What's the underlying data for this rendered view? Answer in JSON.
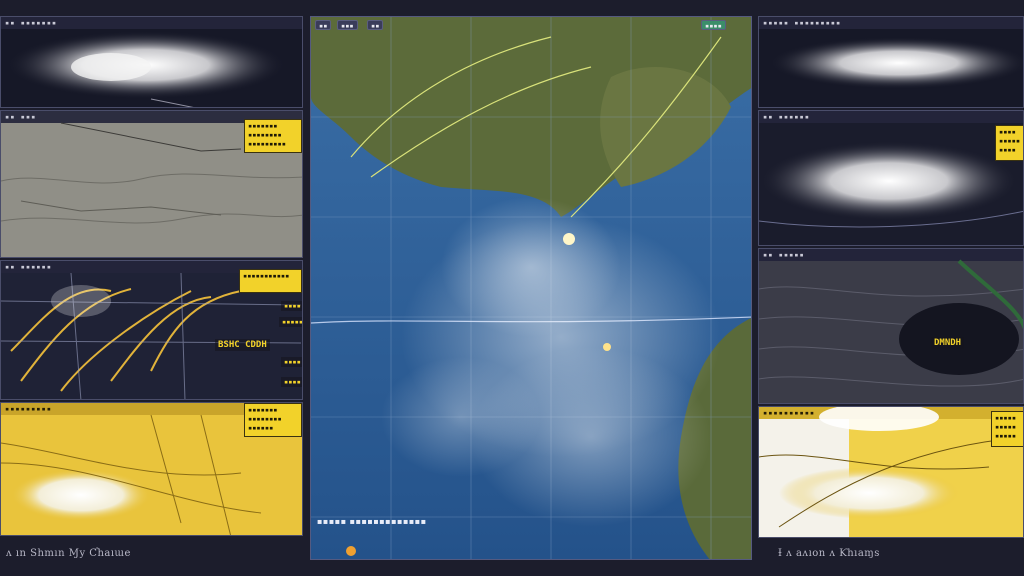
{
  "app": {
    "theme_colors": {
      "background": "#1c1d2c",
      "accent": "#f2d22a",
      "ocean": "#2e5f96"
    }
  },
  "left_column": {
    "panel1": {
      "header": "▪▪ ▪▪▪▪▪▪▪",
      "icon": "cyclone-satellite-icon"
    },
    "panel2": {
      "header": "▪▪ ▪▪▪",
      "tag": "▪▪▪▪▪▪▪\n▪▪▪▪▪▪▪▪\n▪▪▪▪▪▪▪▪▪"
    },
    "panel3": {
      "header": "▪▪ ▪▪▪▪▪▪",
      "tag": "▪▪▪▪▪▪▪▪▪▪▪",
      "label_main": "BSHC CDDH",
      "side_labels": [
        "▪▪▪▪",
        "▪▪▪▪▪",
        "▪▪▪▪",
        "▪▪▪▪"
      ]
    },
    "panel4": {
      "header": "▪▪▪▪▪▪▪▪▪",
      "tag": "▪▪▪▪▪▪▪\n▪▪▪▪▪▪▪▪\n▪▪▪▪▪▪"
    }
  },
  "center_map": {
    "chips": [
      "▪▪",
      "▪▪▪",
      "▪▪",
      "▪▪▪▪"
    ],
    "footer_text": "▪▪▪▪▪ ▪▪▪▪▪▪▪▪▪▪▪▪▪"
  },
  "right_column": {
    "panel1": {
      "header": "▪▪▪▪▪ ▪▪▪▪▪▪▪▪▪",
      "icon": "cyclone-satellite-icon"
    },
    "panel2": {
      "header": "▪▪ ▪▪▪▪▪▪",
      "tag": "▪▪▪▪\n▪▪▪▪▪\n▪▪▪▪"
    },
    "panel3": {
      "header": "▪▪ ▪▪▪▪▪",
      "label_main": "DMNDH"
    },
    "panel4": {
      "header": "▪▪▪▪▪▪▪▪▪▪",
      "tag": "▪▪▪▪▪\n▪▪▪▪▪\n▪▪▪▪▪"
    }
  },
  "captions": {
    "left": "ʌ ın Shmın Ɱy Ƈhaıɯe",
    "right": "Ɨ ʌ aʌıon ʌ Ƙhıaɱs"
  }
}
